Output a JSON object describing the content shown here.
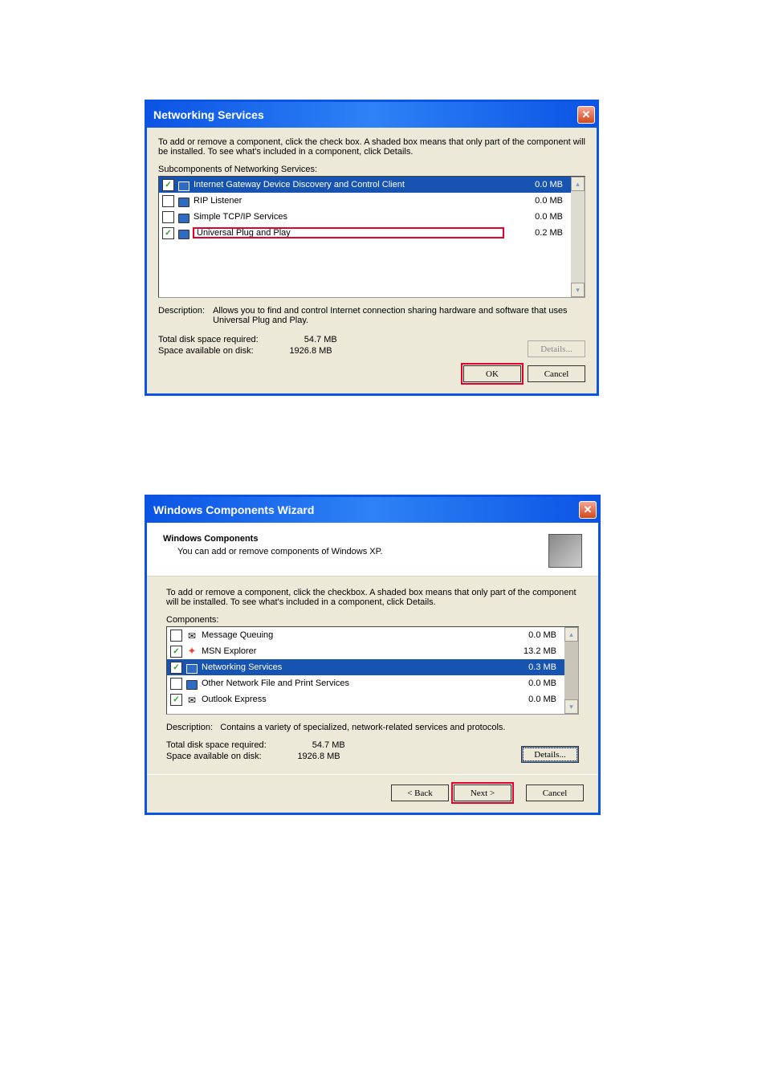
{
  "dialog1": {
    "title": "Networking Services",
    "intro": "To add or remove a component, click the check box. A shaded box means that only part of the component will be installed. To see what's included in a component, click Details.",
    "subLabel": "Subcomponents of Networking Services:",
    "items": [
      {
        "checked": true,
        "name": "Internet Gateway Device Discovery and Control Client",
        "size": "0.0 MB",
        "selected": true
      },
      {
        "checked": false,
        "name": "RIP Listener",
        "size": "0.0 MB",
        "selected": false
      },
      {
        "checked": false,
        "name": "Simple TCP/IP Services",
        "size": "0.0 MB",
        "selected": false
      },
      {
        "checked": true,
        "name": "Universal Plug and Play",
        "size": "0.2 MB",
        "selected": false,
        "highlight": true
      }
    ],
    "descLabel": "Description:",
    "descText": "Allows you to find and control Internet connection sharing hardware and software that uses Universal Plug and Play.",
    "totalReqLabel": "Total disk space required:",
    "totalReqVal": "54.7 MB",
    "spaceAvailLabel": "Space available on disk:",
    "spaceAvailVal": "1926.8 MB",
    "detailsBtn": "Details...",
    "okBtn": "OK",
    "cancelBtn": "Cancel"
  },
  "dialog2": {
    "title": "Windows Components Wizard",
    "heading": "Windows Components",
    "subheading": "You can add or remove components of Windows XP.",
    "intro": "To add or remove a component, click the checkbox.  A shaded box means that only part of the component will be installed.  To see what's included in a component, click Details.",
    "compLabel": "Components:",
    "items": [
      {
        "checked": false,
        "name": "Message Queuing",
        "size": "0.0 MB"
      },
      {
        "checked": true,
        "name": "MSN Explorer",
        "size": "13.2 MB"
      },
      {
        "checked": true,
        "name": "Networking Services",
        "size": "0.3 MB",
        "selected": true
      },
      {
        "checked": false,
        "name": "Other Network File and Print Services",
        "size": "0.0 MB"
      },
      {
        "checked": true,
        "name": "Outlook Express",
        "size": "0.0 MB"
      }
    ],
    "descLabel": "Description:",
    "descText": "Contains a variety of specialized, network-related services and protocols.",
    "totalReqLabel": "Total disk space required:",
    "totalReqVal": "54.7 MB",
    "spaceAvailLabel": "Space available on disk:",
    "spaceAvailVal": "1926.8 MB",
    "detailsBtn": "Details...",
    "backBtn": "< Back",
    "nextBtn": "Next >",
    "cancelBtn": "Cancel"
  }
}
